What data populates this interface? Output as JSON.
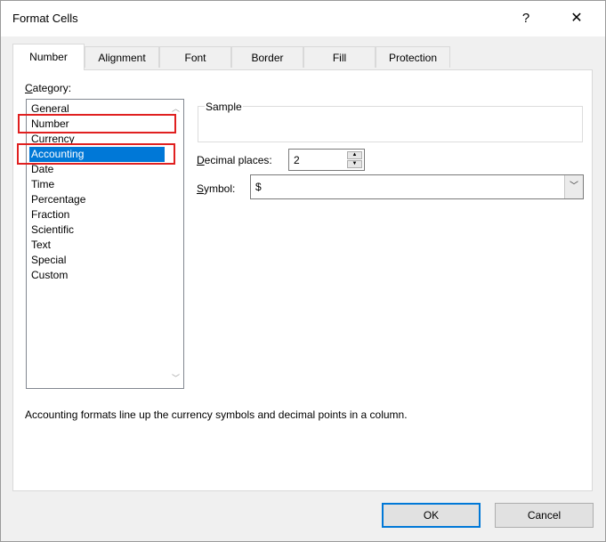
{
  "window": {
    "title": "Format Cells",
    "help_label": "?",
    "close_label": "✕"
  },
  "tabs": [
    {
      "label": "Number",
      "active": true
    },
    {
      "label": "Alignment",
      "active": false
    },
    {
      "label": "Font",
      "active": false
    },
    {
      "label": "Border",
      "active": false
    },
    {
      "label": "Fill",
      "active": false
    },
    {
      "label": "Protection",
      "active": false
    }
  ],
  "category": {
    "label_mnemonic": "C",
    "label_rest": "ategory:",
    "items": [
      "General",
      "Number",
      "Currency",
      "Accounting",
      "Date",
      "Time",
      "Percentage",
      "Fraction",
      "Scientific",
      "Text",
      "Special",
      "Custom"
    ],
    "selected": "Accounting"
  },
  "sample": {
    "legend": "Sample"
  },
  "decimal_places": {
    "label_mnemonic": "D",
    "label_rest": "ecimal places:",
    "value": "2"
  },
  "symbol": {
    "label_mnemonic": "S",
    "label_rest": "ymbol:",
    "value": "$"
  },
  "description": "Accounting formats line up the currency symbols and decimal points in a column.",
  "buttons": {
    "ok": "OK",
    "cancel": "Cancel"
  },
  "colors": {
    "selection": "#0078d7",
    "annotation": "#e02020"
  }
}
